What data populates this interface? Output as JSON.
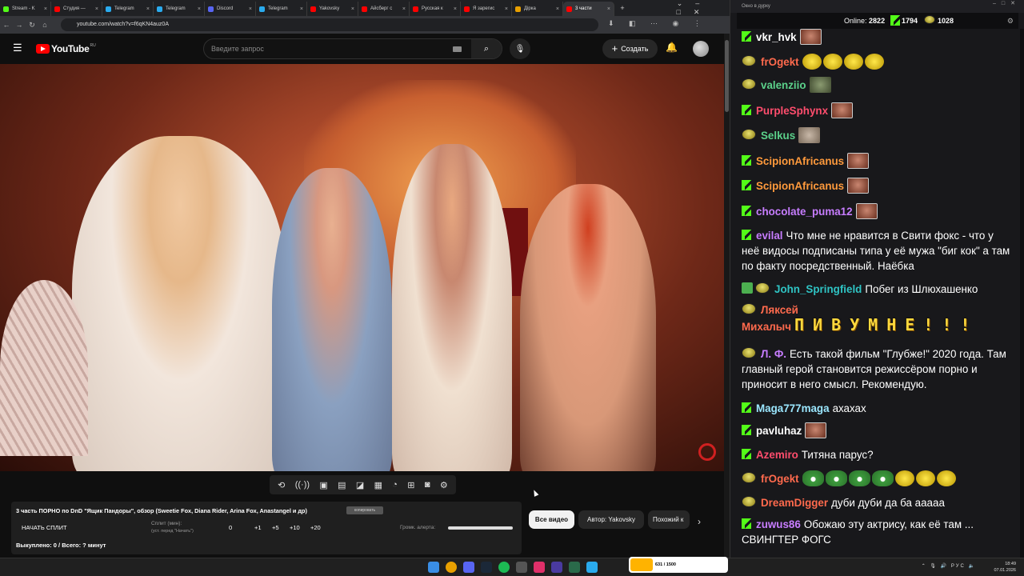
{
  "browser": {
    "tabs": [
      {
        "label": "Stream - K",
        "color": "#53fc18"
      },
      {
        "label": "Студия —",
        "color": "#ff0000"
      },
      {
        "label": "Telegram",
        "color": "#2aabee"
      },
      {
        "label": "Telegram",
        "color": "#2aabee"
      },
      {
        "label": "Discord",
        "color": "#5865f2"
      },
      {
        "label": "Telegram",
        "color": "#2aabee"
      },
      {
        "label": "Yakovsky",
        "color": "#ff0000"
      },
      {
        "label": "Айсберг с",
        "color": "#ff0000"
      },
      {
        "label": "Русская к",
        "color": "#ff0000"
      },
      {
        "label": "Я зарегис",
        "color": "#ff0000"
      },
      {
        "label": "Дірка",
        "color": "#e8a000"
      },
      {
        "label": "3 части",
        "color": "#ff0000"
      }
    ],
    "url": "youtube.com/watch?v=f6qKN4auz0A"
  },
  "youtube": {
    "logo": "YouTube",
    "region": "RU",
    "search_placeholder": "Введите запрос",
    "create_label": "Создать",
    "icons": [
      "menu-icon",
      "search-icon",
      "mic-icon",
      "bell-icon"
    ]
  },
  "player_toolbar": {
    "icons": [
      "loop-icon",
      "broadcast-icon",
      "watch-later-icon",
      "clip-icon",
      "miniplayer-icon",
      "subtitles-icon",
      "speed-icon",
      "add-icon",
      "screenshot-icon",
      "settings-icon"
    ]
  },
  "split_panel": {
    "title": "3 часть ПОРНО по DnD \"Ящик Пандоры\", обзор (Sweetie Fox, Diana Rider, Arina Fox, Anastangel и др)",
    "copy_label": "копировать",
    "start_label": "НАЧАТЬ СПЛИТ",
    "split_label": "Сплит (мин):",
    "split_sub": "(уст. перед \"Начать\")",
    "split_value": "0",
    "increments": [
      "+1",
      "+5",
      "+10",
      "+20"
    ],
    "alert_label": "Громк. алерта:",
    "alert_volume": 1.0,
    "progress": "Выкуплено: 0 / Всего: ? минут"
  },
  "chips": {
    "all": "Все видео",
    "author": "Автор: Yakovsky",
    "similar": "Похожий к"
  },
  "chat": {
    "window_title": "Окно в дурку",
    "online_label": "Online:",
    "online_count": "2822",
    "kick_count": "1794",
    "points_count": "1028",
    "messages": [
      {
        "badge": "k",
        "name": "vkr_hvk",
        "color": "#ffffff",
        "emotes": [
          "face"
        ]
      },
      {
        "badge": "p",
        "name": "frOgekt",
        "color": "#ff6a4d",
        "emotes": [
          "yel",
          "yel",
          "yel",
          "yel"
        ]
      },
      {
        "badge": "p",
        "name": "valenziio",
        "color": "#5bd18a",
        "emotes": [
          "man"
        ]
      },
      {
        "badge": "k",
        "name": "PurpleSphynx",
        "color": "#ff4d6d",
        "emotes": [
          "face"
        ]
      },
      {
        "badge": "p",
        "name": "Selkus",
        "color": "#5bd18a",
        "emotes": [
          "cat"
        ]
      },
      {
        "badge": "k",
        "name": "ScipionAfricanus",
        "color": "#ff9a3c",
        "emotes": [
          "face"
        ]
      },
      {
        "badge": "k",
        "name": "ScipionAfricanus",
        "color": "#ff9a3c",
        "emotes": [
          "face"
        ]
      },
      {
        "badge": "k",
        "name": "chocolate_puma12",
        "color": "#c77dff",
        "emotes": [
          "face"
        ]
      },
      {
        "badge": "k",
        "name": "evilal",
        "color": "#c77dff",
        "text": "Что мне не нравится в Свити фокс - что у неё видосы подписаны типа у её мужа \"биг кок\" а там по факту посредственный. Наёбка"
      },
      {
        "badge": "ok",
        "name": "John_Springfield",
        "color": "#2fc4c4",
        "text": "Побег из Шлюхашенко"
      },
      {
        "badge": "p",
        "name": "Ляксей Михалыч",
        "color": "#ff6a4d",
        "big": "ПИВУМНЕ!!!"
      },
      {
        "badge": "p",
        "name": "Л. Ф.",
        "color": "#c77dff",
        "text": "Есть такой фильм \"Глубже!\" 2020 года. Там главный герой становится режиссёром порно и приносит в него смысл. Рекомендую."
      },
      {
        "badge": "k",
        "name": "Maga777maga",
        "color": "#9be7ff",
        "text": "ахахах"
      },
      {
        "badge": "k",
        "name": "pavluhaz",
        "color": "#ffffff",
        "emotes": [
          "face"
        ]
      },
      {
        "badge": "k",
        "name": "Azemiro",
        "color": "#ff4d6d",
        "text": "Титяна парус?"
      },
      {
        "badge": "p",
        "name": "frOgekt",
        "color": "#ff6a4d",
        "emotes": [
          "pepe",
          "pepe",
          "pepe",
          "pepe",
          "yel",
          "yel",
          "yel"
        ]
      },
      {
        "badge": "p",
        "name": "DreamDigger",
        "color": "#ff6a4d",
        "text": "дуби дуби да ба ааааа"
      },
      {
        "badge": "k",
        "name": "zuwus86",
        "color": "#c77dff",
        "text": "Обожаю эту актрису, как её там ... СВИНГТЕР ФОГС"
      }
    ]
  },
  "taskbar": {
    "meme_label": "631 / 1500",
    "lang": "РУС",
    "time": "18:49",
    "date": "07.01.2026"
  }
}
